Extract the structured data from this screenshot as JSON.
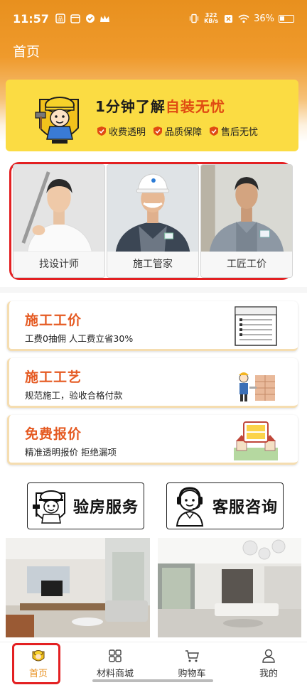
{
  "status_bar": {
    "time": "11:57",
    "speed_top": "322",
    "speed_bottom": "KB/s",
    "battery": "36%"
  },
  "header": {
    "title": "首页"
  },
  "promo": {
    "title_prefix": "1分钟了解",
    "title_highlight": "自装无忧",
    "tags": [
      "收费透明",
      "品质保障",
      "售后无忧"
    ],
    "accent": "#e04b12",
    "background": "#fbdc43"
  },
  "workers": [
    {
      "label": "找设计师"
    },
    {
      "label": "施工管家"
    },
    {
      "label": "工匠工价"
    }
  ],
  "services": [
    {
      "title": "施工工价",
      "subtitle": "工费0抽佣 人工费立省30%",
      "art_caption": "施工价格一览"
    },
    {
      "title": "施工工艺",
      "subtitle": "规范施工，验收合格付款",
      "art_caption": "施工工艺步骤"
    },
    {
      "title": "免费报价",
      "subtitle": "精准透明报价 拒绝漏项",
      "art_caption": "免费报价"
    }
  ],
  "big_buttons": [
    {
      "label": "验房服务",
      "icon": "inspector-mascot-icon"
    },
    {
      "label": "客服咨询",
      "icon": "customer-service-icon"
    }
  ],
  "bottom_nav": [
    {
      "label": "首页",
      "icon": "home-mascot-icon",
      "active": true
    },
    {
      "label": "材料商城",
      "icon": "grid-icon",
      "active": false
    },
    {
      "label": "购物车",
      "icon": "cart-icon",
      "active": false
    },
    {
      "label": "我的",
      "icon": "user-icon",
      "active": false
    }
  ],
  "colors": {
    "primary": "#e8901e",
    "service_title": "#e55a22",
    "highlight_box": "#e32022"
  }
}
